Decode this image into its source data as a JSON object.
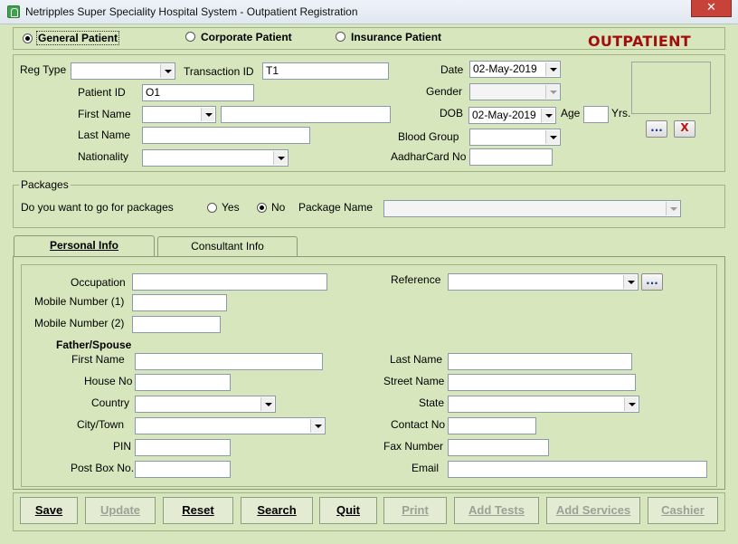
{
  "window": {
    "title": "Netripples Super Speciality Hospital  System - Outpatient Registration",
    "close_label": "✕"
  },
  "patient_type": {
    "options": [
      {
        "label": "General Patient",
        "selected": true
      },
      {
        "label": "Corporate Patient",
        "selected": false
      },
      {
        "label": "Insurance Patient",
        "selected": false
      }
    ],
    "badge": "OUTPATIENT"
  },
  "registration": {
    "reg_type": {
      "label": "Reg Type",
      "value": ""
    },
    "transaction_id": {
      "label": "Transaction ID",
      "value": "T1"
    },
    "date": {
      "label": "Date",
      "value": "02-May-2019"
    },
    "patient_id": {
      "label": "Patient ID",
      "value": "O1"
    },
    "gender": {
      "label": "Gender",
      "value": ""
    },
    "first_name": {
      "label": "First Name",
      "title_value": "",
      "value": ""
    },
    "dob": {
      "label": "DOB",
      "value": "02-May-2019"
    },
    "age": {
      "label": "Age",
      "value": "",
      "unit": "Yrs."
    },
    "last_name": {
      "label": "Last Name",
      "value": ""
    },
    "blood_group": {
      "label": "Blood Group",
      "value": ""
    },
    "nationality": {
      "label": "Nationality",
      "value": ""
    },
    "aadhar": {
      "label": "AadharCard No",
      "value": ""
    },
    "photo_browse_label": "...",
    "photo_clear_label": "X"
  },
  "packages": {
    "legend": "Packages",
    "question": "Do you want to go for packages",
    "yes_label": "Yes",
    "no_label": "No",
    "selected": "No",
    "package_name_label": "Package Name",
    "package_name_value": ""
  },
  "tabs": [
    {
      "label": "Personal Info",
      "active": true
    },
    {
      "label": "Consultant Info",
      "active": false
    }
  ],
  "personal": {
    "occupation": {
      "label": "Occupation",
      "value": ""
    },
    "reference": {
      "label": "Reference",
      "value": "",
      "browse_label": "..."
    },
    "mobile1": {
      "label": "Mobile Number (1)",
      "value": ""
    },
    "mobile2": {
      "label": "Mobile Number (2)",
      "value": ""
    },
    "father_spouse_heading": "Father/Spouse",
    "fs_first_name": {
      "label": "First Name",
      "value": ""
    },
    "fs_last_name": {
      "label": "Last Name",
      "value": ""
    },
    "house_no": {
      "label": "House No",
      "value": ""
    },
    "street_name": {
      "label": "Street Name",
      "value": ""
    },
    "country": {
      "label": "Country",
      "value": ""
    },
    "state": {
      "label": "State",
      "value": ""
    },
    "city": {
      "label": "City/Town",
      "value": ""
    },
    "contact_no": {
      "label": "Contact No",
      "value": ""
    },
    "pin": {
      "label": "PIN",
      "value": ""
    },
    "fax": {
      "label": "Fax Number",
      "value": ""
    },
    "post_box": {
      "label": "Post Box No.",
      "value": ""
    },
    "email": {
      "label": "Email",
      "value": ""
    }
  },
  "buttons": {
    "save": "Save",
    "update": "Update",
    "reset": "Reset",
    "search": "Search",
    "quit": "Quit",
    "print": "Print",
    "add_tests": "Add Tests",
    "add_services": "Add Services",
    "cashier": "Cashier"
  },
  "colors": {
    "background": "#d7e6bd",
    "badge": "#a30d0d",
    "close": "#c7433a"
  }
}
